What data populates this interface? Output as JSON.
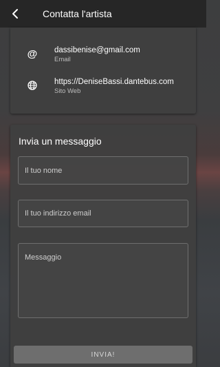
{
  "app_bar": {
    "title": "Contatta l'artista",
    "back_icon": "arrow-left-icon"
  },
  "contacts": [
    {
      "icon": "at-sign-icon",
      "value": "dassibenise@gmail.com",
      "label": "Email"
    },
    {
      "icon": "globe-icon",
      "value": "https://DeniseBassi.dantebus.com",
      "label": "Sito Web"
    }
  ],
  "form": {
    "title": "Invia un messaggio",
    "name_placeholder": "Il tuo nome",
    "email_placeholder": "Il tuo indirizzo email",
    "message_placeholder": "Messaggio",
    "send_label": "INVIA!"
  },
  "colors": {
    "app_bar": "#262626",
    "card": "#404040",
    "button": "#6e6e6e"
  }
}
